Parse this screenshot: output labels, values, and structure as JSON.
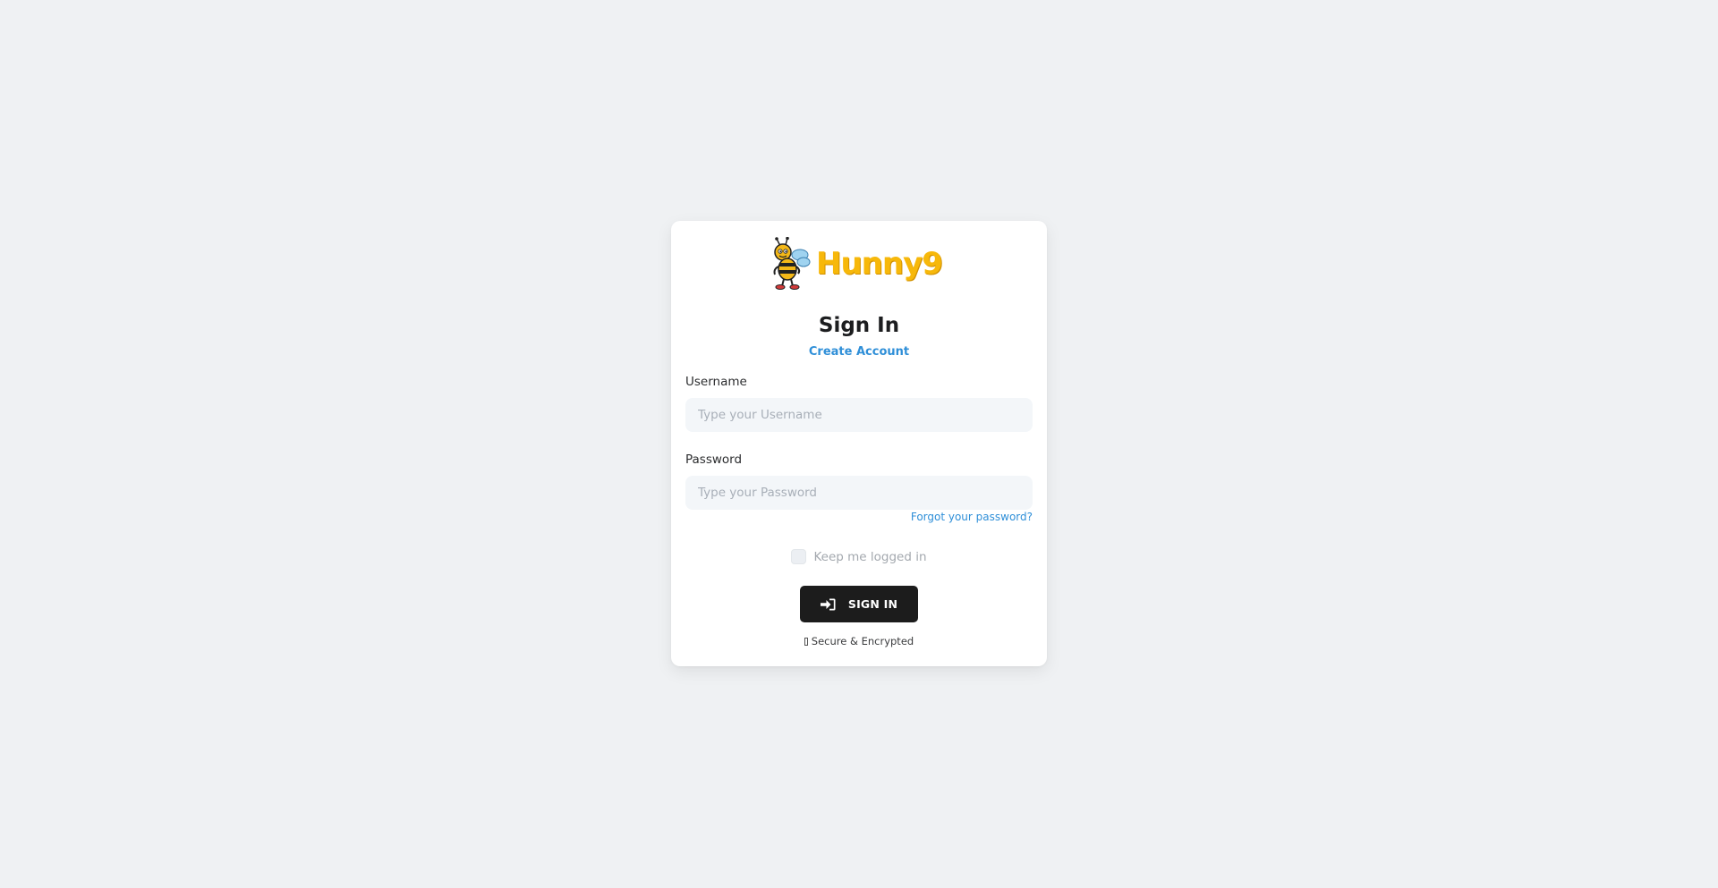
{
  "brand": {
    "name": "Hunny9",
    "logo_icon": "bee-mascot-icon",
    "accent_color": "#f7b80a"
  },
  "form": {
    "title": "Sign In",
    "create_account_label": "Create Account",
    "username": {
      "label": "Username",
      "placeholder": "Type your Username",
      "value": ""
    },
    "password": {
      "label": "Password",
      "placeholder": "Type your Password",
      "value": ""
    },
    "forgot_password_label": "Forgot your password?",
    "remember_me": {
      "label": "Keep me logged in",
      "checked": false
    },
    "submit": {
      "label": "SIGN IN",
      "icon": "sign-in-icon"
    },
    "secure_note": {
      "icon": "lock-icon",
      "label": "Secure & Encrypted"
    }
  },
  "colors": {
    "page_background": "#eff1f3",
    "card_background": "#ffffff",
    "link": "#2f8fd8",
    "button_background": "#1c1c1c",
    "input_background": "#f3f6f9"
  }
}
